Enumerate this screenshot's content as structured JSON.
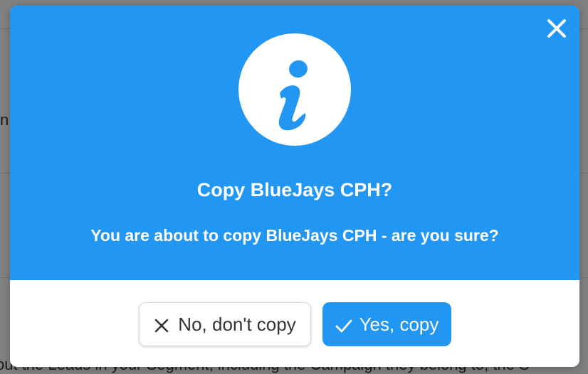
{
  "background": {
    "partial_text_left": "n",
    "partial_text_bottom": "out the Leads in your Segment, including the Campaign they belong to, the S"
  },
  "modal": {
    "title": "Copy BlueJays CPH?",
    "message": "You are about to copy BlueJays CPH - are you sure?",
    "icon": "info-icon",
    "close_icon": "close-icon",
    "colors": {
      "header": "#2196f3",
      "primary_button": "#2196f3",
      "text_light": "#ffffff"
    }
  },
  "buttons": {
    "cancel_label": "No, don't copy",
    "cancel_icon": "x-icon",
    "confirm_label": "Yes, copy",
    "confirm_icon": "check-icon"
  }
}
